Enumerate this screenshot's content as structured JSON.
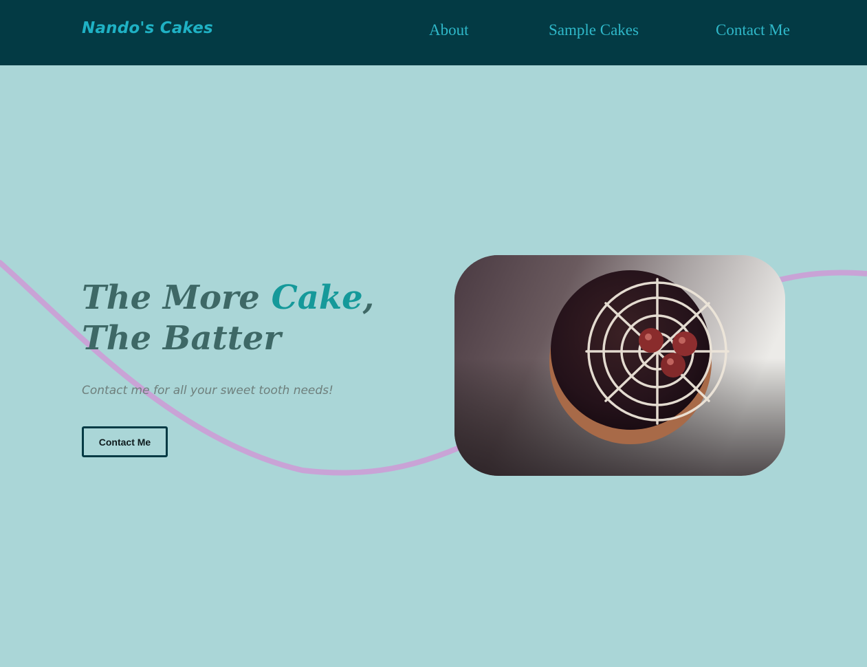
{
  "nav": {
    "brand": "Nando's Cakes",
    "links": [
      "About",
      "Sample Cakes",
      "Contact Me"
    ]
  },
  "hero": {
    "title_prefix": "The More ",
    "title_accent": "Cake",
    "title_comma": ",",
    "title_line2": "The Batter",
    "subtitle": "Contact me for all your sweet tooth needs!",
    "button_label": "Contact Me"
  },
  "colors": {
    "background": "#aad6d7",
    "navbar": "#033a44",
    "brand": "#1fb1c4",
    "nav_link": "#2fb8c9",
    "title": "#3e6866",
    "accent": "#15999a",
    "wave": "#c9a3d6"
  }
}
